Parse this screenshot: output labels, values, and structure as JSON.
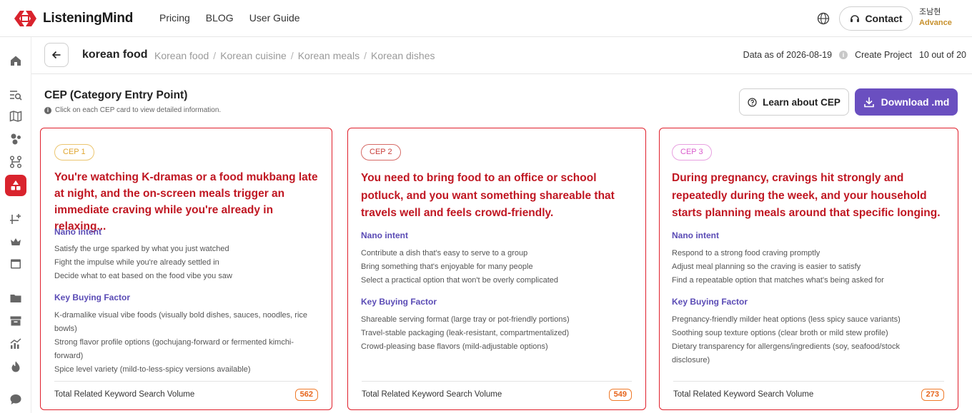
{
  "nav": {
    "logo_text": "ListeningMind",
    "links": [
      "Pricing",
      "BLOG",
      "User Guide"
    ],
    "contact_label": "Contact",
    "user_name": "조남현",
    "user_plan": "Advance"
  },
  "breadcrumb": {
    "main": "korean food",
    "items": [
      "Korean food",
      "Korean cuisine",
      "Korean meals",
      "Korean dishes"
    ],
    "data_as_of": "Data as of 2026-08-19",
    "create_project": "Create Project",
    "count": "10 out of 20"
  },
  "section": {
    "title": "CEP (Category Entry Point)",
    "hint": "Click on each CEP card to view detailed information.",
    "learn_label": "Learn about CEP",
    "download_label": "Download .md"
  },
  "cards": [
    {
      "badge": "CEP 1",
      "badge_color": "#e9b84a",
      "title": "You're watching K-dramas or a food mukbang late at night, and the on-screen meals trigger an immediate craving while you're already in relaxing...",
      "nano_label": "Nano intent",
      "nano": [
        "Satisfy the urge sparked by what you just watched",
        "Fight the impulse while you're already settled in",
        "Decide what to eat based on the food vibe you saw"
      ],
      "kbf_label": "Key Buying Factor",
      "kbf": [
        "K-dramalike visual vibe foods (visually bold dishes, sauces, noodles, rice bowls)",
        "Strong flavor profile options (gochujang-forward or fermented kimchi-forward)",
        "Spice level variety (mild-to-less-spicy versions available)"
      ],
      "foot_label": "Total Related Keyword Search Volume",
      "volume": "562"
    },
    {
      "badge": "CEP 2",
      "badge_color": "#c9413d",
      "title": "You need to bring food to an office or school potluck, and you want something shareable that travels well and feels crowd-friendly.",
      "nano_label": "Nano intent",
      "nano": [
        "Contribute a dish that's easy to serve to a group",
        "Bring something that's enjoyable for many people",
        "Select a practical option that won't be overly complicated"
      ],
      "kbf_label": "Key Buying Factor",
      "kbf": [
        "Shareable serving format (large tray or pot-friendly portions)",
        "Travel-stable packaging (leak-resistant, compartmentalized)",
        "Crowd-pleasing base flavors (mild-adjustable options)"
      ],
      "foot_label": "Total Related Keyword Search Volume",
      "volume": "549"
    },
    {
      "badge": "CEP 3",
      "badge_color": "#e06fd5",
      "title": "During pregnancy, cravings hit strongly and repeatedly during the week, and your household starts planning meals around that specific longing.",
      "nano_label": "Nano intent",
      "nano": [
        "Respond to a strong food craving promptly",
        "Adjust meal planning so the craving is easier to satisfy",
        "Find a repeatable option that matches what's being asked for"
      ],
      "kbf_label": "Key Buying Factor",
      "kbf": [
        "Pregnancy-friendly milder heat options (less spicy sauce variants)",
        "Soothing soup texture options (clear broth or mild stew profile)",
        "Dietary transparency for allergens/ingredients (soy, seafood/stock disclosure)"
      ],
      "foot_label": "Total Related Keyword Search Volume",
      "volume": "273"
    }
  ]
}
